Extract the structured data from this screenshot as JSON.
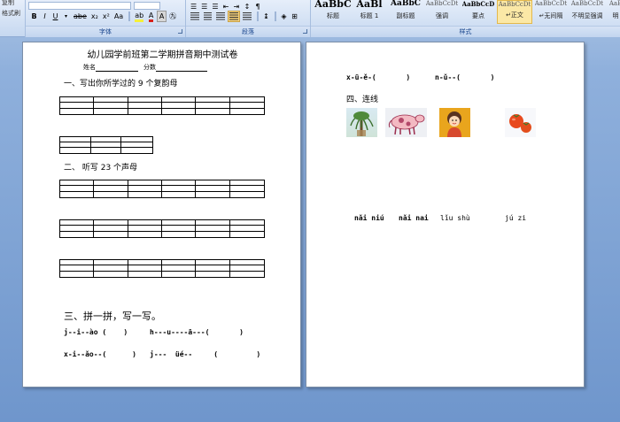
{
  "ribbon": {
    "clipboard": {
      "copy": "复制",
      "format_painter": "格式刷"
    },
    "font_group": {
      "label": "字体",
      "buttons": [
        "B",
        "I",
        "U",
        "abe",
        "x₂",
        "x²",
        "Aa",
        "A",
        "A"
      ]
    },
    "paragraph_group": {
      "label": "段落"
    },
    "styles_group": {
      "label": "样式",
      "styles": [
        {
          "sample": "AaBbC",
          "name": "标题"
        },
        {
          "sample": "AaBl",
          "name": "标题 1"
        },
        {
          "sample": "AaBbC",
          "name": "副标题"
        },
        {
          "sample": "AaBbCcDt",
          "name": "强调"
        },
        {
          "sample": "AaBbCcD",
          "name": "要点"
        },
        {
          "sample": "AaBbCcDt",
          "name": "↵正文"
        },
        {
          "sample": "AaBbCcDt",
          "name": "↵无间隔"
        },
        {
          "sample": "AaBbCcDt",
          "name": "不明显强调"
        },
        {
          "sample": "AaB",
          "name": "明"
        }
      ]
    }
  },
  "page_left": {
    "title": "幼儿园学前班第二学期拼音期中测试卷",
    "name_label": "姓名",
    "score_label": "分数",
    "q1": "一、写出你所学过的 9 个复韵母",
    "q2": "二、 听写 23 个声母",
    "q3": "三、拼一拼，写一写。",
    "lines": [
      {
        "a": "j--i--ào (    )",
        "b": "h---u----ā---(       )"
      },
      {
        "a": "x-i--ǎo--(      )",
        "b": "j---  üé--     (         )"
      }
    ]
  },
  "page_right": {
    "line1_a": "x-ü-ě-(       )",
    "line1_b": "n-ǔ--(       )",
    "q4": "四、连线",
    "images": [
      "tree",
      "cow",
      "boy",
      "fruit"
    ],
    "words": [
      "nǎi niú",
      "nǎi nai",
      "lǐu shù",
      "jú zi"
    ]
  },
  "colors": {
    "accent": "#15428b",
    "ribbon_selected": "#fbe8a6"
  }
}
